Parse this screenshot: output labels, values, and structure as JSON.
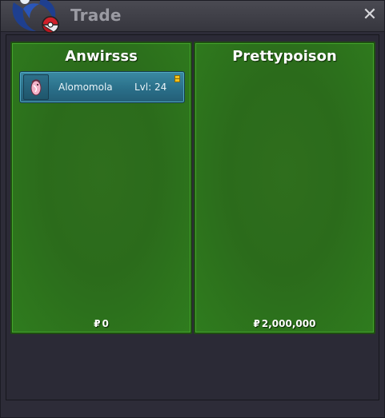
{
  "window": {
    "title": "Trade",
    "close_glyph": "✕"
  },
  "icons": {
    "logo": "pokeball-logo-icon",
    "close": "close-icon",
    "pokemon": "pokemon-sprite-icon",
    "currency": "pokedollar-icon",
    "badge": "held-item-icon"
  },
  "colors": {
    "panel_green": "#2f7c1e",
    "row_blue": "#2a6f89",
    "badge_yellow": "#f5c21b"
  },
  "trade": {
    "left": {
      "player_name": "Anwirsss",
      "pokemon": [
        {
          "name": "Alomomola",
          "level_text": "Lvl: 24"
        }
      ],
      "money_symbol": "₽",
      "money": "0"
    },
    "right": {
      "player_name": "Prettypoison",
      "pokemon": [],
      "money_symbol": "₽",
      "money": "2,000,000"
    }
  }
}
